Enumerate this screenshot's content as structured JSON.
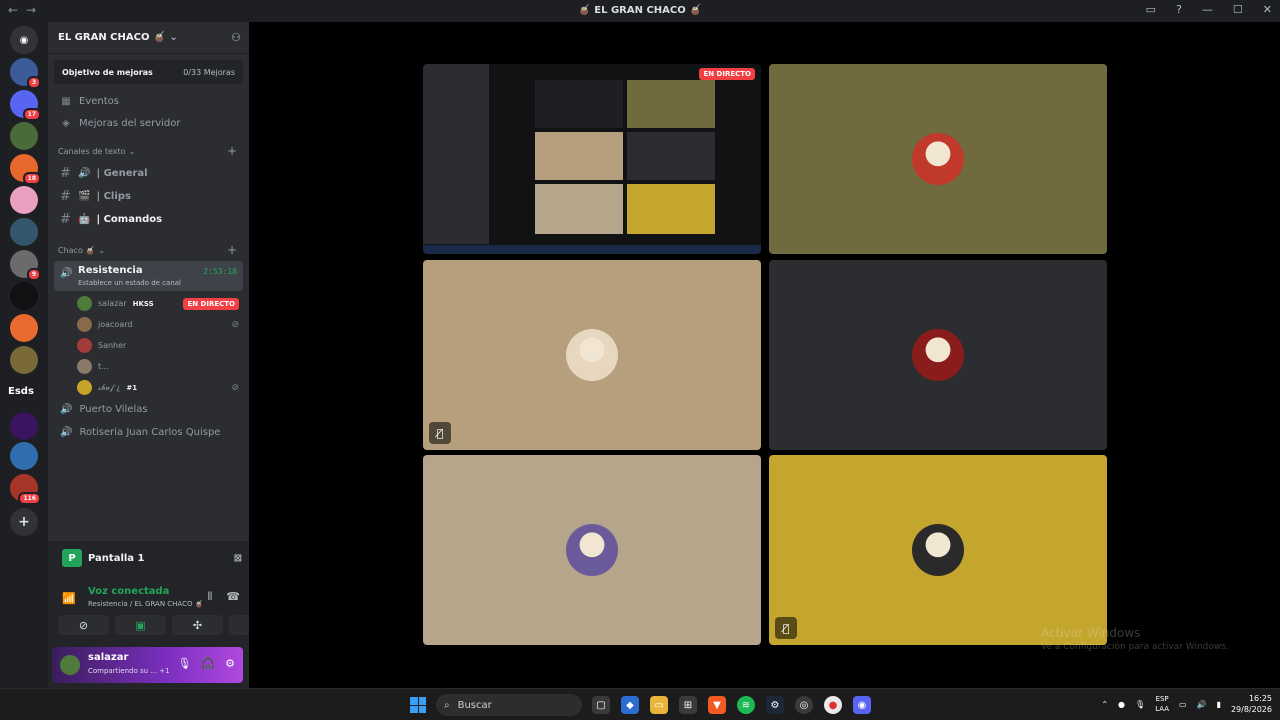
{
  "window": {
    "title": "🧉 EL GRAN CHACO 🧉"
  },
  "servers": [
    {
      "badge": "3",
      "color": "#3b5b9a"
    },
    {
      "badge": "17",
      "color": "#5865f2"
    },
    {
      "badge": "",
      "color": "#4a6a3a"
    },
    {
      "badge": "18",
      "color": "#e8672b"
    },
    {
      "badge": "",
      "color": "#e9a1c2"
    },
    {
      "badge": "",
      "color": "#33566d"
    },
    {
      "badge": "9",
      "color": "#6b6b6b"
    },
    {
      "badge": "",
      "color": "#111214"
    },
    {
      "badge": "",
      "color": "#ea6a2d"
    },
    {
      "badge": "",
      "color": "#7a6a3a"
    },
    {
      "badge": "",
      "color": "#3b1460"
    },
    {
      "badge": "",
      "color": "#2f6fb0"
    },
    {
      "badge": "116",
      "color": "#a8352a"
    }
  ],
  "server_text": "Esds",
  "server_header": {
    "name": "EL GRAN CHACO 🧉"
  },
  "boost": {
    "label": "Objetivo de mejoras",
    "count": "0/33 Mejoras"
  },
  "menu": [
    {
      "label": "Eventos"
    },
    {
      "label": "Mejoras del servidor"
    }
  ],
  "text_category": {
    "label": "Canales de texto"
  },
  "text_channels": [
    {
      "label": "| General"
    },
    {
      "label": "| Clips"
    },
    {
      "label": "| Comandos"
    }
  ],
  "voice_category": {
    "label": "Chaco 🧉"
  },
  "active_voice": {
    "name": "Resistencia",
    "status": "Establece un estado de canal",
    "time": "2:53:18"
  },
  "members": [
    {
      "name": "salazar",
      "tag": "HKSS",
      "live": "EN DIRECTO",
      "color": "#4e7a3a"
    },
    {
      "name": "joacoard",
      "tag": "",
      "live": "",
      "color": "#8a6a4a"
    },
    {
      "name": "Sanher",
      "tag": "",
      "live": "",
      "color": "#a33b3b"
    },
    {
      "name": "t...",
      "tag": "",
      "live": "",
      "color": "#8a7a6a"
    },
    {
      "name": "𝓈𝒽𝓊𝒻 ¿",
      "tag": "#1",
      "live": "",
      "color": "#c8a32a"
    }
  ],
  "voice_channels": [
    {
      "label": "Puerto Vilelas"
    },
    {
      "label": "Rotiseria Juan Carlos Quispe"
    }
  ],
  "screen_share": {
    "label": "Pantalla 1",
    "pic": "P"
  },
  "voice_connected": {
    "label": "Voz conectada",
    "sub": "Resistencia / EL GRAN CHACO 🧉"
  },
  "user": {
    "name": "salazar",
    "status": "Compartiendo su ...",
    "extra": "+1"
  },
  "stage": {
    "live_label": "EN DIRECTO",
    "tiles": [
      {
        "bg": "#6f6b3f",
        "avatar": "#c0392b"
      },
      {
        "bg": "#b59f7c",
        "avatar": "#e7d7bf"
      },
      {
        "bg": "#2b2d31",
        "avatar": "#8a1c1c"
      },
      {
        "bg": "#b5a58b",
        "avatar": "#6a5a9a"
      },
      {
        "bg": "#c4a62f",
        "avatar": "#2a2a2a"
      }
    ]
  },
  "watermark": {
    "line1": "Activar Windows",
    "line2": "Ve a Configuración para activar Windows."
  },
  "taskbar": {
    "search": "Buscar",
    "lang_top": "ESP",
    "lang_bottom": "LAA",
    "time": "16:25",
    "date": "29/8/2026"
  },
  "colors": {
    "accent": "#5865f2",
    "live": "#f23f43",
    "connected": "#23a559"
  }
}
